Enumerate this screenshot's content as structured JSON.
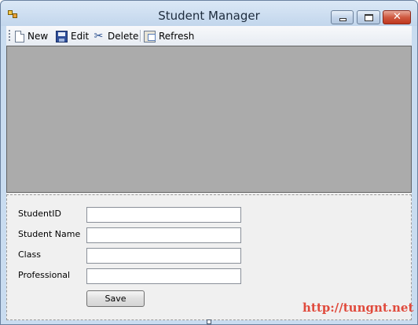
{
  "window": {
    "title": "Student Manager"
  },
  "toolbar": {
    "items": [
      {
        "label": "New",
        "icon": "new-document-icon"
      },
      {
        "label": "Edit",
        "icon": "save-disk-icon"
      },
      {
        "label": "Delete",
        "icon": "scissors-icon"
      },
      {
        "label": "Refresh",
        "icon": "refresh-icon"
      }
    ]
  },
  "form": {
    "fields": [
      {
        "label": "StudentID",
        "value": ""
      },
      {
        "label": "Student Name",
        "value": ""
      },
      {
        "label": "Class",
        "value": ""
      },
      {
        "label": "Professional",
        "value": ""
      }
    ],
    "save_label": "Save"
  },
  "watermark": "http://tungnt.net",
  "colors": {
    "grid_background": "#ababab",
    "watermark": "#e04a3c"
  }
}
